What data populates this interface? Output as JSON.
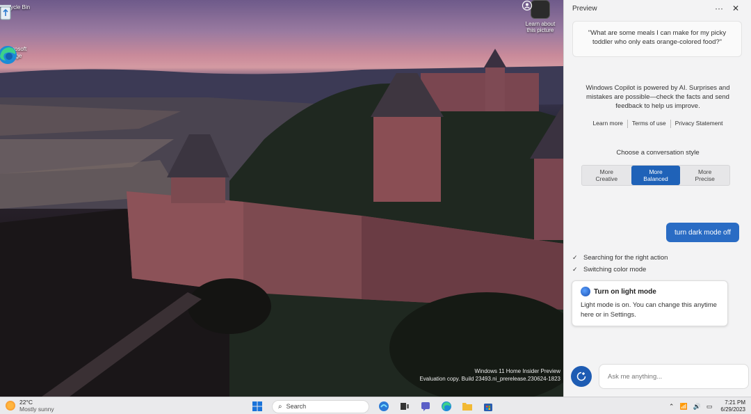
{
  "desktop": {
    "icons": [
      {
        "label": "Recycle Bin",
        "icon": "recycle-bin-icon"
      },
      {
        "label": "Microsoft Edge",
        "icon": "edge-icon"
      }
    ],
    "learn_picture": "Learn about this picture",
    "watermark": {
      "line1": "Windows 11 Home Insider Preview",
      "line2": "Evaluation copy. Build 23493.ni_prerelease.230624-1823"
    }
  },
  "copilot": {
    "header": {
      "title": "Preview",
      "more": "···",
      "close": "✕"
    },
    "suggestion": "\"What are some meals I can make for my picky toddler who only eats orange-colored food?\"",
    "disclaimer": "Windows Copilot is powered by AI. Surprises and mistakes are possible—check the facts and send feedback to help us improve.",
    "links": [
      "Learn more",
      "Terms of use",
      "Privacy Statement"
    ],
    "style_label": "Choose a conversation style",
    "styles": [
      {
        "line1": "More",
        "line2": "Creative",
        "active": false
      },
      {
        "line1": "More",
        "line2": "Balanced",
        "active": true
      },
      {
        "line1": "More",
        "line2": "Precise",
        "active": false
      }
    ],
    "user_message": "turn dark mode off",
    "steps": [
      "Searching for the right action",
      "Switching color mode"
    ],
    "action_card": {
      "title": "Turn on light mode",
      "body": "Light mode is on. You can change this anytime here or in Settings."
    },
    "input_placeholder": "Ask me anything..."
  },
  "taskbar": {
    "weather": {
      "temp": "22°C",
      "condition": "Mostly sunny"
    },
    "search_label": "Search",
    "clock": {
      "time": "7:21 PM",
      "date": "6/29/2023"
    }
  },
  "colors": {
    "accent": "#1f62b8",
    "user_bubble": "#2a6cc4",
    "panel_bg": "#f3f3f4",
    "taskbar_bg": "#eaeaec"
  }
}
